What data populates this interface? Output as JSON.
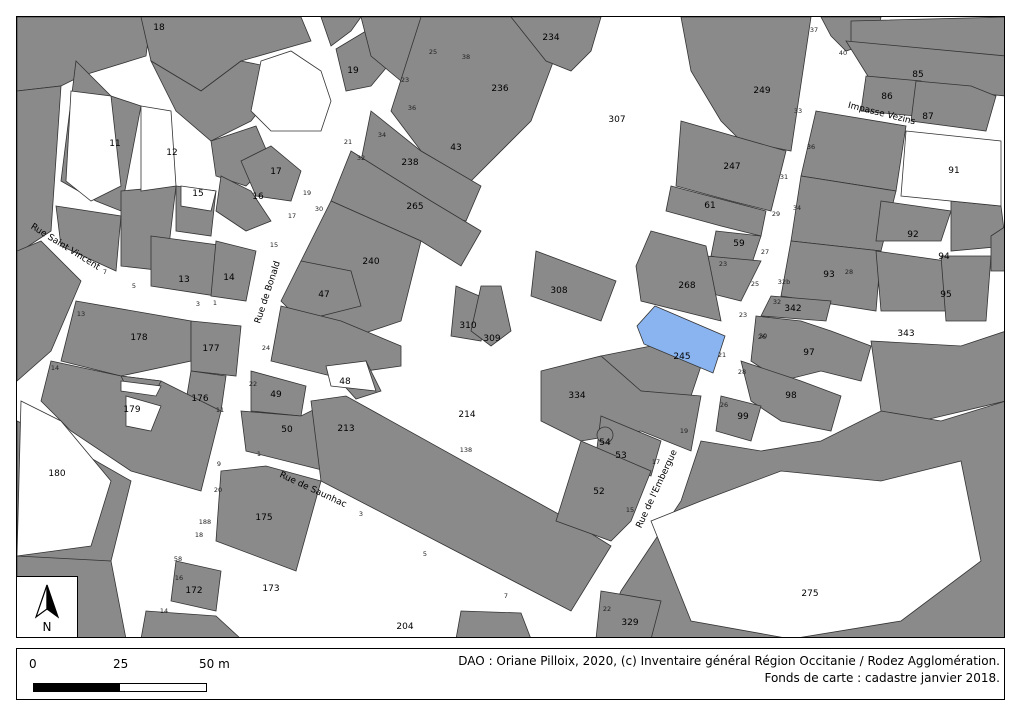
{
  "map": {
    "highlighted_parcel": "245",
    "colors": {
      "building": "#8a8a8a",
      "highlight": "#8ab4ef",
      "ground": "#ffffff"
    },
    "streets": [
      "Rue Saint Vincent",
      "Rue de Bonald",
      "Rue de Saunhac",
      "Rue de l'Embergue",
      "Impasse Vezins"
    ],
    "parcels": [
      "18",
      "19",
      "234",
      "236",
      "307",
      "249",
      "85",
      "86",
      "87",
      "91",
      "11",
      "12",
      "17",
      "15",
      "16",
      "43",
      "238",
      "247",
      "61",
      "92",
      "94",
      "265",
      "59",
      "240",
      "23",
      "268",
      "93",
      "95",
      "342",
      "343",
      "13",
      "14",
      "47",
      "308",
      "310",
      "309",
      "245",
      "97",
      "178",
      "177",
      "334",
      "98",
      "99",
      "179",
      "176",
      "48",
      "49",
      "214",
      "54",
      "53",
      "180",
      "50",
      "213",
      "52",
      "175",
      "173",
      "275",
      "172",
      "204",
      "329"
    ],
    "street_numbers": [
      "37",
      "40",
      "33",
      "25",
      "38",
      "23",
      "36",
      "34",
      "21",
      "32",
      "19",
      "30",
      "17",
      "15",
      "36",
      "31",
      "34",
      "29",
      "27",
      "32b",
      "25",
      "32",
      "28",
      "26",
      "7",
      "5",
      "3",
      "1",
      "13",
      "24",
      "22",
      "14",
      "11",
      "9",
      "1",
      "20",
      "188",
      "18",
      "16",
      "14",
      "58",
      "3",
      "5",
      "7",
      "138",
      "19",
      "17",
      "15",
      "22",
      "30",
      "28",
      "26",
      "23",
      "21"
    ]
  },
  "north_arrow": {
    "label": "N"
  },
  "scale": {
    "label_0": "0",
    "label_25": "25",
    "label_50": "50 m"
  },
  "credits": {
    "line1": "DAO : Oriane Pilloix, 2020, (c) Inventaire général Région Occitanie / Rodez Agglomération.",
    "line2": "Fonds de carte : cadastre janvier 2018."
  }
}
